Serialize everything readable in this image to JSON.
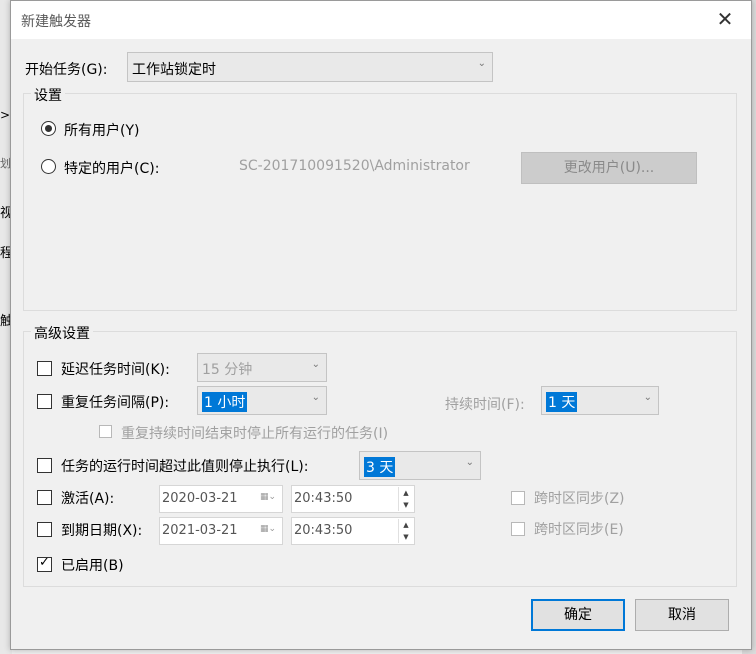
{
  "dialog": {
    "title": "新建触发器",
    "close_glyph": "✕"
  },
  "background_fragments": {
    "frag1": ">",
    "frag2": "划",
    "frag3": "视",
    "frag4": "程",
    "frag5": "触"
  },
  "start_task": {
    "label": "开始任务(G):",
    "value": "工作站锁定时"
  },
  "settings": {
    "title": "设置",
    "all_users_label": "所有用户(Y)",
    "specific_user_label": "特定的用户(C):",
    "user_name": "SC-201710091520\\Administrator",
    "change_user_button": "更改用户(U)..."
  },
  "advanced": {
    "title": "高级设置",
    "delay_label": "延迟任务时间(K):",
    "delay_value": "15 分钟",
    "repeat_label": "重复任务间隔(P):",
    "repeat_value": "1 小时",
    "duration_label": "持续时间(F):",
    "duration_value": "1 天",
    "stop_repeat_label": "重复持续时间结束时停止所有运行的任务(I)",
    "stop_exceed_label": "任务的运行时间超过此值则停止执行(L):",
    "stop_exceed_value": "3 天",
    "activate_label": "激活(A):",
    "activate_date": "2020-03-21",
    "activate_time": "20:43:50",
    "activate_sync_label": "跨时区同步(Z)",
    "expire_label": "到期日期(X):",
    "expire_date": "2021-03-21",
    "expire_time": "20:43:50",
    "expire_sync_label": "跨时区同步(E)",
    "enabled_label": "已启用(B)"
  },
  "buttons": {
    "ok": "确定",
    "cancel": "取消"
  },
  "icons": {
    "dropdown": "chevron-down-icon",
    "date_picker": "calendar-icon",
    "spinner": "spinner-arrows-icon",
    "close": "close-icon",
    "checkmark": "checkmark-icon"
  },
  "colors": {
    "selection": "#0078d7",
    "dialog_bg": "#f0f0f0",
    "disabled_text": "#a0a0a0"
  },
  "state": {
    "all_users_selected": true,
    "enabled_checked": true
  }
}
